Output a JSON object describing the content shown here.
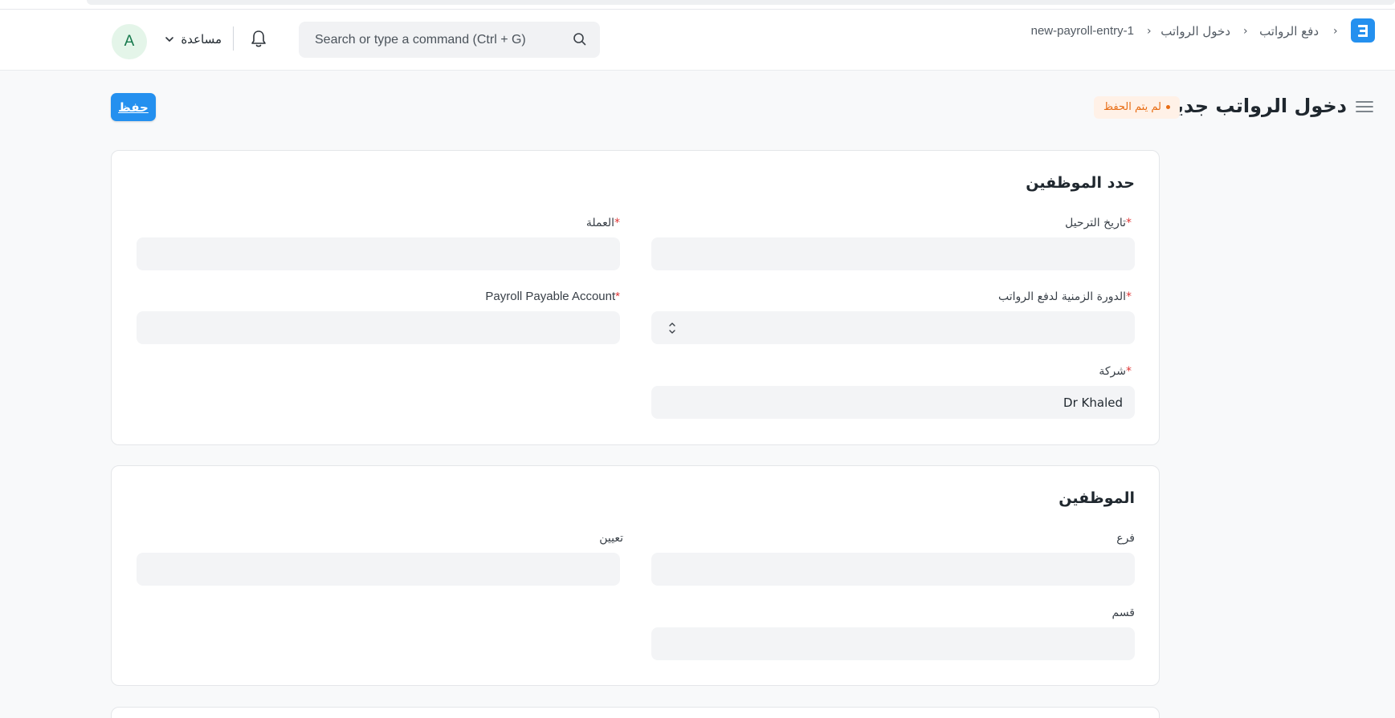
{
  "navbar": {
    "breadcrumbs": [
      "دفع الرواتب",
      "دخول الرواتب",
      "new-payroll-entry-1"
    ],
    "separator": "›",
    "search_placeholder": "Search or type a command (Ctrl + G)",
    "help_label": "مساعدة",
    "avatar_initial": "A"
  },
  "page": {
    "title": "دخول الرواتب جديد",
    "status": "لم يتم الحفظ",
    "save_label": "حفظ"
  },
  "sections": [
    {
      "title": "حدد الموظفين",
      "fields": [
        {
          "label": "تاريخ الترحيل",
          "required": true,
          "value": ""
        },
        {
          "label": "العملة",
          "required": true,
          "value": ""
        },
        {
          "label": "الدورة الزمنية لدفع الرواتب",
          "required": true,
          "value": ""
        },
        {
          "label": "Payroll Payable Account",
          "required": true,
          "value": ""
        },
        {
          "label": "شركة",
          "required": true,
          "value": "Dr Khaled"
        }
      ]
    },
    {
      "title": "الموظفين",
      "fields": [
        {
          "label": "فرع",
          "required": false,
          "value": ""
        },
        {
          "label": "تعيين",
          "required": false,
          "value": ""
        },
        {
          "label": "قسم",
          "required": false,
          "value": ""
        }
      ]
    }
  ],
  "colors": {
    "primary": "#2490ef",
    "status": "#e86c13",
    "status_bg": "#fff1e7",
    "required": "#e03636",
    "avatar_bg": "#e4f5e9",
    "avatar_fg": "#16794c"
  },
  "icons": [
    "app-logo-icon",
    "search-icon",
    "bell-icon",
    "chevron-down-icon",
    "hamburger-menu-icon",
    "select-stepper-icon"
  ]
}
